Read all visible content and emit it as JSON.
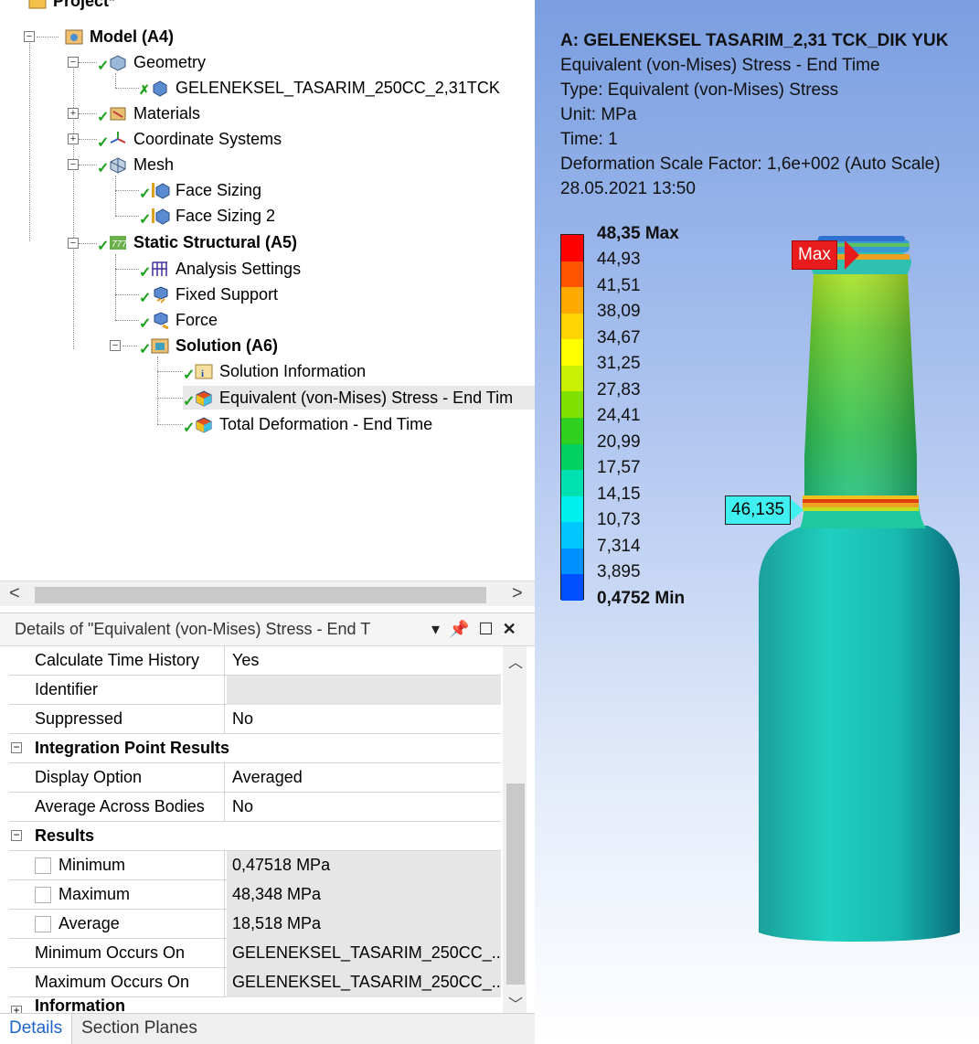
{
  "tree": {
    "project": "Project*",
    "model": "Model (A4)",
    "geometry": "Geometry",
    "part": "GELENEKSEL_TASARIM_250CC_2,31TCK",
    "materials": "Materials",
    "coordinate_systems": "Coordinate Systems",
    "mesh": "Mesh",
    "face_sizing": "Face Sizing",
    "face_sizing_2": "Face Sizing 2",
    "static_structural": "Static Structural (A5)",
    "analysis_settings": "Analysis Settings",
    "fixed_support": "Fixed Support",
    "force": "Force",
    "solution": "Solution (A6)",
    "solution_information": "Solution Information",
    "equivalent_stress": "Equivalent (von-Mises) Stress - End Tim",
    "total_deformation": "Total Deformation - End Time"
  },
  "scrollbar": {
    "left_arrow": "<",
    "right_arrow": ">"
  },
  "details": {
    "title": "Details of \"Equivalent (von-Mises) Stress - End T",
    "rows": [
      {
        "key": "Calculate Time History",
        "value": "Yes"
      },
      {
        "key": "Identifier",
        "value": ""
      },
      {
        "key": "Suppressed",
        "value": "No"
      }
    ],
    "section_integration": "Integration Point Results",
    "integration_rows": [
      {
        "key": "Display Option",
        "value": "Averaged"
      },
      {
        "key": "Average Across Bodies",
        "value": "No"
      }
    ],
    "section_results": "Results",
    "result_rows": [
      {
        "key": "Minimum",
        "value": "0,47518 MPa"
      },
      {
        "key": "Maximum",
        "value": "48,348 MPa"
      },
      {
        "key": "Average",
        "value": "18,518 MPa"
      },
      {
        "key": "Minimum Occurs On",
        "value": "GELENEKSEL_TASARIM_250CC_..."
      },
      {
        "key": "Maximum Occurs On",
        "value": "GELENEKSEL_TASARIM_250CC_..."
      }
    ],
    "section_information": "Information"
  },
  "tabs": {
    "details": "Details",
    "section_planes": "Section Planes"
  },
  "viewport": {
    "title": "A: GELENEKSEL TASARIM_2,31 TCK_DIK YUK",
    "line1": "Equivalent (von-Mises) Stress - End Time",
    "line2": "Type: Equivalent (von-Mises) Stress",
    "line3": "Unit: MPa",
    "line4": "Time: 1",
    "line5": "Deformation Scale Factor: 1,6e+002 (Auto Scale)",
    "line6": "28.05.2021 13:50",
    "legend": [
      "48,35 Max",
      "44,93",
      "41,51",
      "38,09",
      "34,67",
      "31,25",
      "27,83",
      "24,41",
      "20,99",
      "17,57",
      "14,15",
      "10,73",
      "7,314",
      "3,895",
      "0,4752 Min"
    ],
    "legend_colors": [
      "#ff0000",
      "#ff5500",
      "#ffaa00",
      "#ffd400",
      "#ffff00",
      "#c8f000",
      "#80e000",
      "#30d020",
      "#00d060",
      "#00e0b0",
      "#00f0f0",
      "#00c8ff",
      "#0090ff",
      "#0050ff",
      "#0000ff"
    ],
    "max_tag": "Max",
    "probe_tag": "46,135"
  }
}
